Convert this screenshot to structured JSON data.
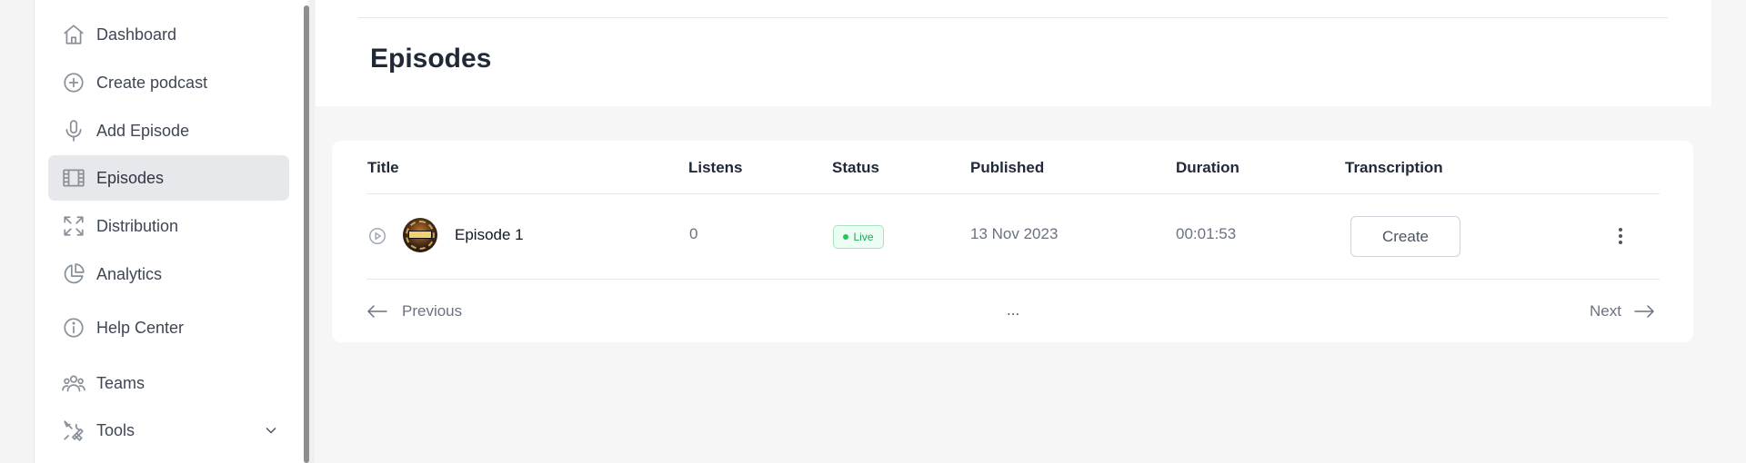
{
  "sidebar": {
    "items": [
      {
        "label": "Dashboard",
        "icon": "home-icon"
      },
      {
        "label": "Create podcast",
        "icon": "plus-circle-icon"
      },
      {
        "label": "Add Episode",
        "icon": "microphone-icon"
      },
      {
        "label": "Episodes",
        "icon": "film-icon",
        "active": true
      },
      {
        "label": "Distribution",
        "icon": "expand-icon"
      },
      {
        "label": "Analytics",
        "icon": "pie-chart-icon"
      },
      {
        "label": "Help Center",
        "icon": "info-icon"
      },
      {
        "label": "Teams",
        "icon": "users-icon"
      },
      {
        "label": "Tools",
        "icon": "tools-icon",
        "has_chevron": true
      }
    ]
  },
  "page": {
    "title": "Episodes"
  },
  "table": {
    "columns": [
      "Title",
      "Listens",
      "Status",
      "Published",
      "Duration",
      "Transcription"
    ],
    "rows": [
      {
        "title": "Episode 1",
        "listens": "0",
        "status": "Live",
        "published": "13 Nov 2023",
        "duration": "00:01:53",
        "transcription_action": "Create"
      }
    ]
  },
  "pagination": {
    "previous": "Previous",
    "next": "Next",
    "ellipsis": "..."
  },
  "colors": {
    "accent_active": "#e7e8eb",
    "status_live": "#22c55e"
  }
}
